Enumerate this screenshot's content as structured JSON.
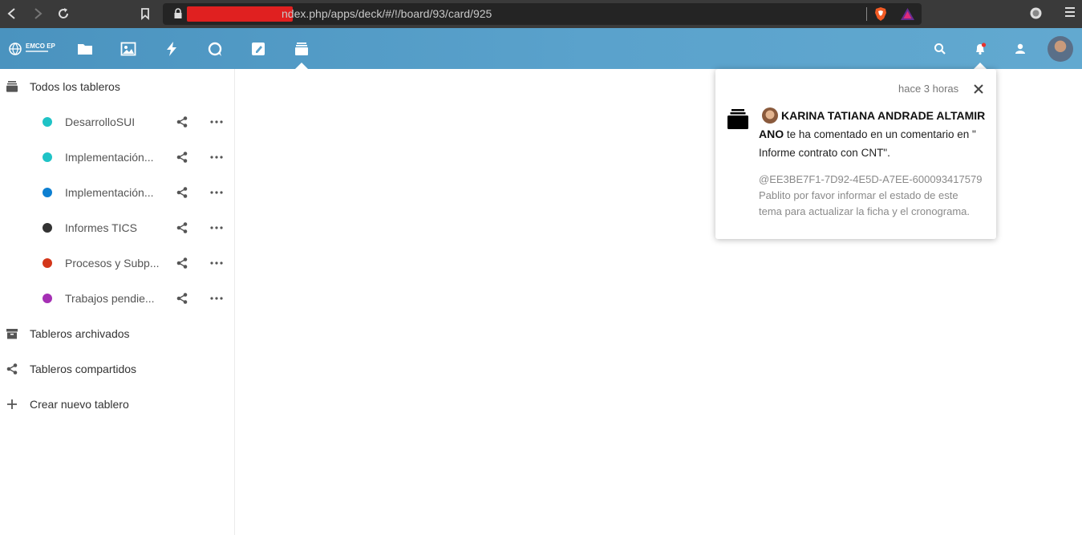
{
  "browser": {
    "url_visible": "ndex.php/apps/deck/#/!/board/93/card/925"
  },
  "header": {
    "logo_text": "EMCO EP",
    "apps": [
      "files-icon",
      "photos-icon",
      "activity-icon",
      "talk-icon",
      "notes-icon",
      "deck-icon"
    ],
    "active_app": "deck-icon"
  },
  "sidebar": {
    "all_boards": "Todos los tableros",
    "boards": [
      {
        "label": "DesarrolloSUI",
        "color": "#1fc3c6"
      },
      {
        "label": "Implementación...",
        "color": "#1fc3c6"
      },
      {
        "label": "Implementación...",
        "color": "#0d7fd1"
      },
      {
        "label": "Informes TICS",
        "color": "#333333"
      },
      {
        "label": "Procesos y Subp...",
        "color": "#d3361a"
      },
      {
        "label": "Trabajos pendie...",
        "color": "#a530b4"
      }
    ],
    "archived": "Tableros archivados",
    "shared": "Tableros compartidos",
    "create": "Crear nuevo tablero"
  },
  "notification": {
    "time": "hace 3 horas",
    "user": "KARINA TATIANA ANDRADE ALTAMIRANO",
    "user_line1": "KARINA TATIANA ANDRADE ALTAMIR",
    "user_line2": "ANO",
    "action_text": " te ha comentado en un comentario en \"",
    "card_text": "Informe contrato con CNT\".",
    "message_line1": "@EE3BE7F1-7D92-4E5D-A7EE-600093417579",
    "message_line2": "Pablito por favor informar el estado de este",
    "message_line3": "tema para actualizar la ficha y el cronograma."
  }
}
